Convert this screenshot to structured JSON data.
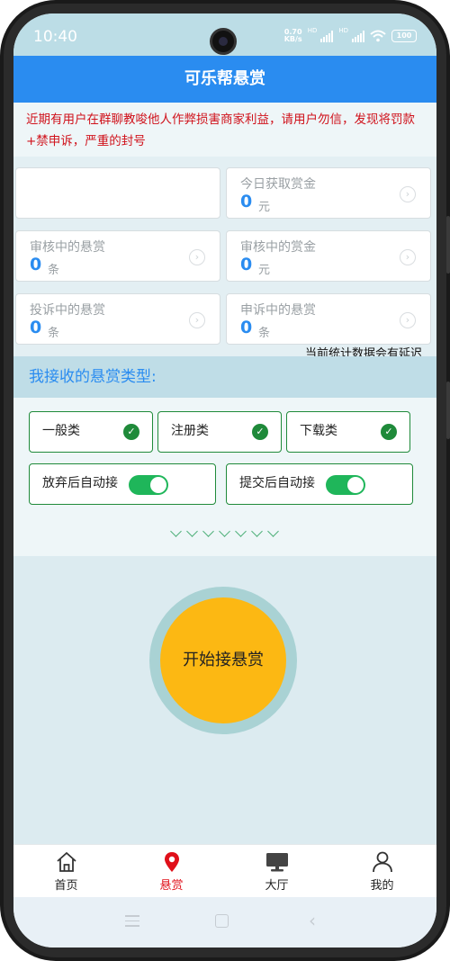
{
  "status_bar": {
    "time": "10:40",
    "net_speed_value": "0.70",
    "net_speed_unit": "KB/s",
    "signal_label_1": "HD",
    "signal_label_2": "HD",
    "battery": "100"
  },
  "header": {
    "title": "可乐帮悬赏"
  },
  "notice": "近期有用户在群聊教唆他人作弊损害商家利益，请用户勿信，发现将罚款+禁申诉，严重的封号",
  "stats": {
    "today_reward": {
      "label": "今日获取赏金",
      "value": "0",
      "unit": "元"
    },
    "reviewing_tasks": {
      "label": "审核中的悬赏",
      "value": "0",
      "unit": "条"
    },
    "reviewing_reward": {
      "label": "审核中的赏金",
      "value": "0",
      "unit": "元"
    },
    "complained_tasks": {
      "label": "投诉中的悬赏",
      "value": "0",
      "unit": "条"
    },
    "appealing_tasks": {
      "label": "申诉中的悬赏",
      "value": "0",
      "unit": "条"
    },
    "delay_note": "当前统计数据会有延迟"
  },
  "types": {
    "title": "我接收的悬赏类型:",
    "items": [
      {
        "label": "一般类",
        "checked": true
      },
      {
        "label": "注册类",
        "checked": true
      },
      {
        "label": "下载类",
        "checked": true
      }
    ],
    "toggles": [
      {
        "label": "放弃后自动接",
        "on": true
      },
      {
        "label": "提交后自动接",
        "on": true
      }
    ]
  },
  "start_button": {
    "label": "开始接悬赏"
  },
  "tab_bar": {
    "items": [
      {
        "label": "首页",
        "icon": "home-icon"
      },
      {
        "label": "悬赏",
        "icon": "location-pin-icon",
        "active": true
      },
      {
        "label": "大厅",
        "icon": "monitor-icon"
      },
      {
        "label": "我的",
        "icon": "user-icon"
      }
    ]
  },
  "colors": {
    "header_blue": "#2a8cf0",
    "notice_red": "#d0121b",
    "check_green": "#1f8a3a",
    "toggle_green": "#1fb65a",
    "start_yellow": "#fcb813",
    "active_tab_red": "#e0101a"
  }
}
